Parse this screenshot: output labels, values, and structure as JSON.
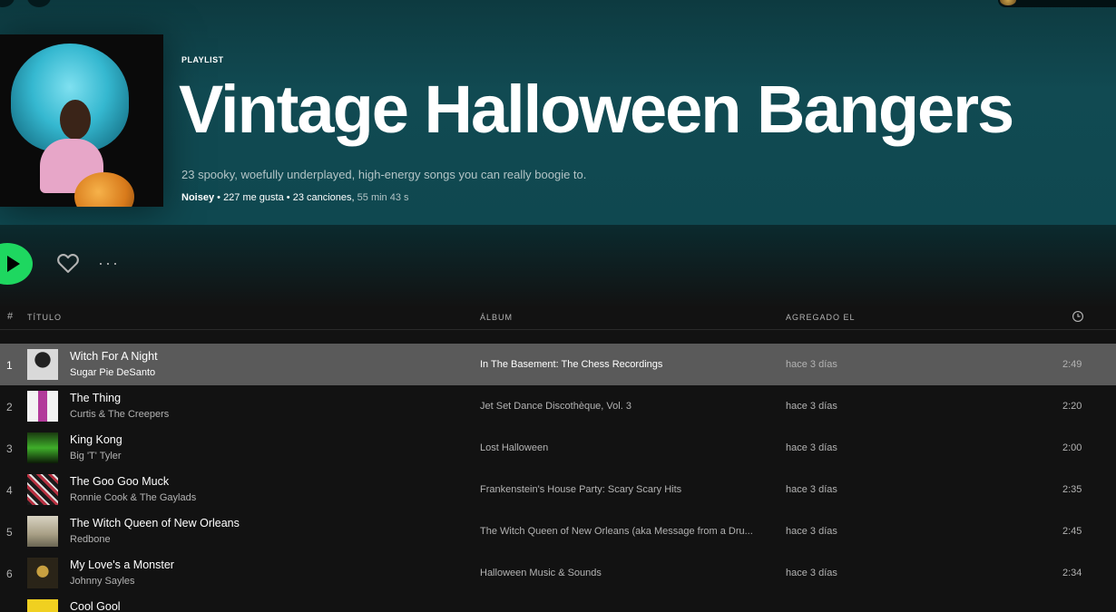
{
  "playlist": {
    "type_label": "PLAYLIST",
    "title": "Vintage Halloween Bangers",
    "description": "23 spooky, woefully underplayed, high-energy songs you can really boogie to.",
    "owner": "Noisey",
    "likes": "227 me gusta",
    "songs": "23 canciones,",
    "duration": "55 min 43 s"
  },
  "actions": {
    "more_label": "···"
  },
  "table": {
    "headers": {
      "num": "#",
      "title": "TÍTULO",
      "album": "ÁLBUM",
      "added": "AGREGADO EL"
    },
    "rows": [
      {
        "num": "1",
        "title": "Witch For A Night",
        "artist": "Sugar Pie DeSanto",
        "album": "In The Basement: The Chess Recordings",
        "added": "hace 3 días",
        "duration": "2:49"
      },
      {
        "num": "2",
        "title": "The Thing",
        "artist": "Curtis & The Creepers",
        "album": "Jet Set Dance Discothèque, Vol. 3",
        "added": "hace 3 días",
        "duration": "2:20"
      },
      {
        "num": "3",
        "title": "King Kong",
        "artist": "Big 'T' Tyler",
        "album": "Lost Halloween",
        "added": "hace 3 días",
        "duration": "2:00"
      },
      {
        "num": "4",
        "title": "The Goo Goo Muck",
        "artist": "Ronnie Cook & The Gaylads",
        "album": "Frankenstein's House Party: Scary Scary Hits",
        "added": "hace 3 días",
        "duration": "2:35"
      },
      {
        "num": "5",
        "title": "The Witch Queen of New Orleans",
        "artist": "Redbone",
        "album": "The Witch Queen of New Orleans (aka Message from a Dru...",
        "added": "hace 3 días",
        "duration": "2:45"
      },
      {
        "num": "6",
        "title": "My Love's a Monster",
        "artist": "Johnny Sayles",
        "album": "Halloween Music & Sounds",
        "added": "hace 3 días",
        "duration": "2:34"
      },
      {
        "num": "",
        "title": "Cool Gool",
        "artist": "",
        "album": "",
        "added": "",
        "duration": ""
      }
    ]
  },
  "colors": {
    "accent": "#1ed760",
    "hero": "#114a52",
    "background": "#121212",
    "selected_row": "#5a5a5a"
  }
}
